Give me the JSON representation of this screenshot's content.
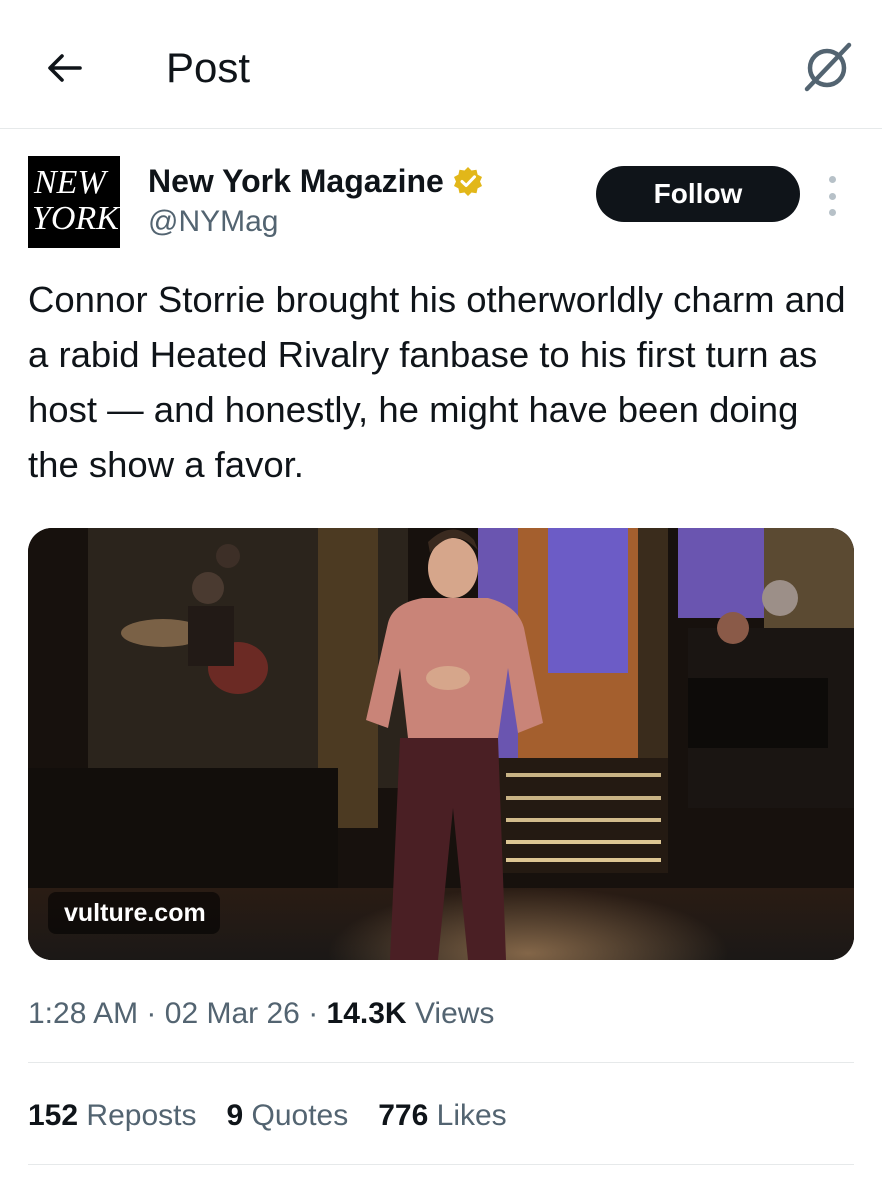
{
  "header": {
    "back_icon": "arrow-left-icon",
    "title": "Post",
    "grok_icon": "grok-slash-icon"
  },
  "author": {
    "avatar_line1": "NEW",
    "avatar_line2": "YORK",
    "name": "New York Magazine",
    "verified_icon": "gold-verified-badge-icon",
    "handle": "@NYMag",
    "follow_label": "Follow",
    "more_icon": "vertical-dots-icon"
  },
  "post": {
    "text": "Connor Storrie brought his otherworldly charm and a rabid Heated Rivalry fanbase to his first turn as host — and honestly, he might have been doing the show a favor.",
    "media_domain": "vulture.com"
  },
  "meta": {
    "time": "1:28 AM",
    "date": "02 Mar 26",
    "views_count": "14.3K",
    "views_label": "Views"
  },
  "stats": {
    "reposts_count": "152",
    "reposts_label": "Reposts",
    "quotes_count": "9",
    "quotes_label": "Quotes",
    "likes_count": "776",
    "likes_label": "Likes"
  },
  "colors": {
    "text": "#0f1419",
    "secondary": "#536471",
    "verified_gold": "#e2b719",
    "follow_bg": "#0f1419"
  }
}
